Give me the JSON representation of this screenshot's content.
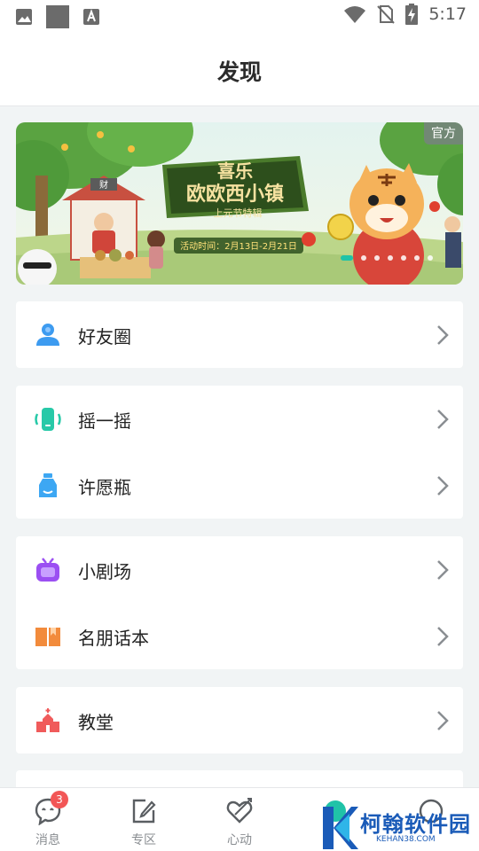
{
  "status_bar": {
    "time": "5:17"
  },
  "header": {
    "title": "发现"
  },
  "banner": {
    "badge": "官方",
    "art_text": {
      "line1": "喜乐",
      "line2": "欧欧西小镇",
      "line3": "上元节特辑",
      "dates": "活动时间：2月13日-2月21日",
      "sign": "财"
    }
  },
  "menu": {
    "moments": "好友圈",
    "shake": "摇一摇",
    "wish_bottle": "许愿瓶",
    "theater": "小剧场",
    "scripts": "名朋话本",
    "church": "教堂"
  },
  "tabbar": {
    "messages": "消息",
    "messages_badge": "3",
    "zone": "专区",
    "heart": "心动"
  },
  "watermark": {
    "text": "柯翰软件园",
    "sub": "KEHAN38.COM"
  },
  "colors": {
    "accent_teal": "#20c3a8",
    "badge_red": "#f25656"
  }
}
